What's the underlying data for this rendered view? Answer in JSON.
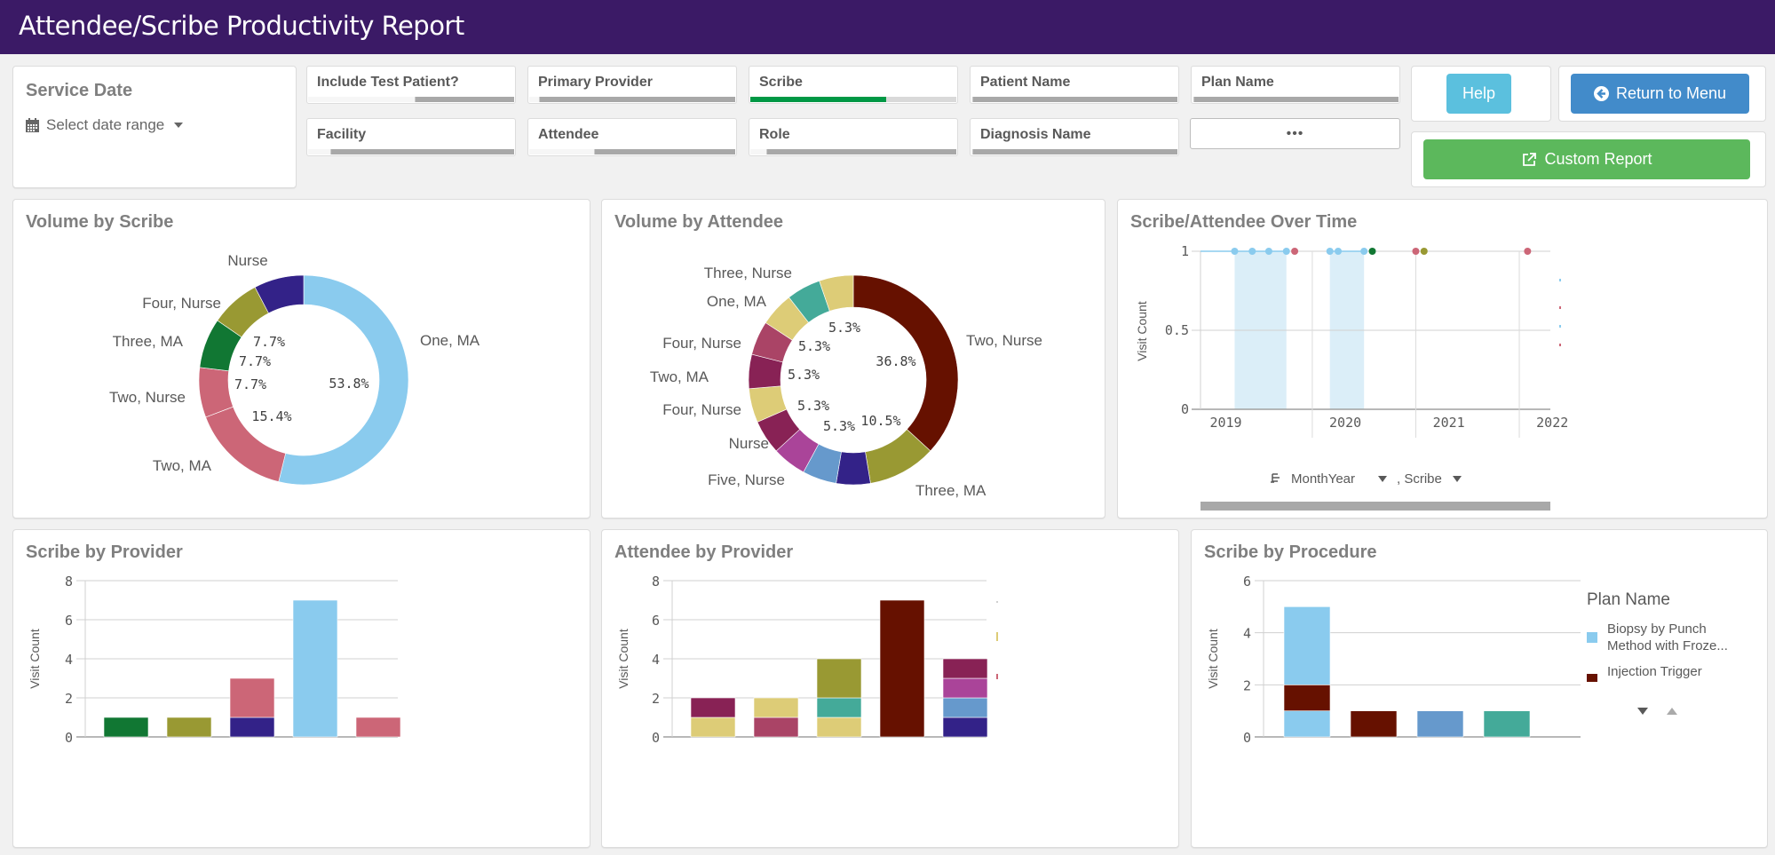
{
  "header": {
    "title": "Attendee/Scribe Productivity Report"
  },
  "filters": {
    "service_date": {
      "label": "Service Date",
      "picker_label": "Select date range"
    },
    "items": [
      {
        "label": "Include Test Patient?",
        "white_fraction": 0.52,
        "selected": false
      },
      {
        "label": "Primary Provider",
        "white_fraction": 0.05,
        "selected": false
      },
      {
        "label": "Scribe",
        "green_fraction": 0.66,
        "selected": true
      },
      {
        "label": "Patient Name",
        "white_fraction": 0.01,
        "selected": false
      },
      {
        "label": "Plan Name",
        "white_fraction": 0.01,
        "selected": false
      },
      {
        "label": "Facility",
        "white_fraction": 0.11,
        "selected": false
      },
      {
        "label": "Attendee",
        "white_fraction": 0.32,
        "selected": false
      },
      {
        "label": "Role",
        "white_fraction": 0.08,
        "selected": false
      },
      {
        "label": "Diagnosis Name",
        "white_fraction": 0.01,
        "selected": false
      }
    ],
    "more_label": "•••"
  },
  "buttons": {
    "help": "Help",
    "return_to_menu": "Return to Menu",
    "custom_report": "Custom Report"
  },
  "colors": {
    "header": "#3b1a66",
    "light_blue": "#8acbee",
    "rose": "#cc6677",
    "green": "#117733",
    "olive": "#999933",
    "indigo": "#332288",
    "maroon": "#661100",
    "sand": "#ddcc77",
    "teal": "#44aa99",
    "wine": "#882255",
    "raspberry": "#aa4466",
    "magenta": "#aa4499",
    "steel_blue": "#6699cc"
  },
  "chart_data": [
    {
      "id": "volume_by_scribe",
      "type": "pie",
      "title": "Volume by Scribe",
      "donut": true,
      "slices": [
        {
          "label": "One, MA",
          "value": 7,
          "pct": "53.8%",
          "color": "#8acbee"
        },
        {
          "label": "Two, MA",
          "value": 2,
          "pct": "15.4%",
          "color": "#cc6677"
        },
        {
          "label": "Two, Nurse",
          "value": 1,
          "pct": "7.7%",
          "color": "#cc6677"
        },
        {
          "label": "Three, MA",
          "value": 1,
          "pct": "7.7%",
          "color": "#117733"
        },
        {
          "label": "Four, Nurse",
          "value": 1,
          "pct": "7.7%",
          "color": "#999933"
        },
        {
          "label": "Nurse",
          "value": 1,
          "pct": "7.7%",
          "color": "#332288"
        }
      ],
      "inner_labels": [
        "53.8%",
        "15.4%",
        "7.7%",
        "7.7%",
        "7.7%"
      ]
    },
    {
      "id": "volume_by_attendee",
      "type": "pie",
      "title": "Volume by Attendee",
      "donut": true,
      "slices": [
        {
          "label": "Two, Nurse",
          "value": 7,
          "pct": "36.8%",
          "color": "#661100"
        },
        {
          "label": "Three, MA",
          "value": 2,
          "pct": "10.5%",
          "color": "#999933"
        },
        {
          "label": "",
          "value": 1,
          "pct": "5.3%",
          "color": "#332288"
        },
        {
          "label": "Five, Nurse",
          "value": 1,
          "pct": "5.3%",
          "color": "#6699cc"
        },
        {
          "label": "",
          "value": 1,
          "pct": "5.3%",
          "color": "#aa4499"
        },
        {
          "label": "Nurse",
          "value": 1,
          "pct": "5.3%",
          "color": "#882255"
        },
        {
          "label": "Four, Nurse",
          "value": 1,
          "pct": "5.3%",
          "color": "#ddcc77"
        },
        {
          "label": "Two, MA",
          "value": 1,
          "pct": "5.3%",
          "color": "#882255"
        },
        {
          "label": "Four, Nurse",
          "value": 1,
          "pct": "5.3%",
          "color": "#aa4466"
        },
        {
          "label": "One, MA",
          "value": 1,
          "pct": "5.3%",
          "color": "#ddcc77"
        },
        {
          "label": "",
          "value": 1,
          "pct": "5.3%",
          "color": "#44aa99"
        },
        {
          "label": "Three, Nurse",
          "value": 1,
          "pct": "5.3%",
          "color": "#ddcc77"
        }
      ],
      "inner_labels": [
        "36.8%",
        "10.5%",
        "5.3%",
        "5.3%",
        "5.3%",
        "5.3%",
        "5.3%"
      ]
    },
    {
      "id": "scribe_attendee_over_time",
      "type": "line",
      "title": "Scribe/Attendee Over Time",
      "ylabel": "Visit Count",
      "yticks": [
        "1",
        "0.5",
        "0"
      ],
      "ylim": [
        0,
        1
      ],
      "xticks": [
        "2019",
        "2020",
        "2021",
        "2022"
      ],
      "points": [
        {
          "t": 2019.0,
          "y": 1,
          "color": "#8acbee"
        },
        {
          "t": 2019.17,
          "y": 1,
          "color": "#8acbee"
        },
        {
          "t": 2019.33,
          "y": 1,
          "color": "#8acbee"
        },
        {
          "t": 2019.5,
          "y": 1,
          "color": "#8acbee"
        },
        {
          "t": 2019.58,
          "y": 1,
          "color": "#cc6677"
        },
        {
          "t": 2019.92,
          "y": 1,
          "color": "#8acbee"
        },
        {
          "t": 2020.0,
          "y": 1,
          "color": "#8acbee"
        },
        {
          "t": 2020.25,
          "y": 1,
          "color": "#8acbee"
        },
        {
          "t": 2020.33,
          "y": 1,
          "color": "#117733"
        },
        {
          "t": 2020.75,
          "y": 1,
          "color": "#cc6677"
        },
        {
          "t": 2020.83,
          "y": 1,
          "color": "#999933"
        },
        {
          "t": 2021.83,
          "y": 1,
          "color": "#cc6677"
        }
      ],
      "shaded_ranges": [
        [
          2019.0,
          2019.5
        ],
        [
          2019.92,
          2020.25
        ]
      ],
      "dimension_labels": [
        "MonthYear",
        ", Scribe"
      ]
    },
    {
      "id": "scribe_by_provider",
      "type": "bar",
      "stacked": true,
      "title": "Scribe by Provider",
      "ylabel": "Visit Count",
      "ylim": [
        0,
        8
      ],
      "yticks": [
        "8",
        "6",
        "4",
        "2",
        "0"
      ],
      "bars": [
        [
          {
            "value": 1,
            "color": "#117733"
          }
        ],
        [
          {
            "value": 1,
            "color": "#999933"
          }
        ],
        [
          {
            "value": 1,
            "color": "#332288"
          },
          {
            "value": 2,
            "color": "#cc6677"
          }
        ],
        [
          {
            "value": 7,
            "color": "#8acbee"
          }
        ],
        [
          {
            "value": 1,
            "color": "#cc6677"
          }
        ]
      ]
    },
    {
      "id": "attendee_by_provider",
      "type": "bar",
      "stacked": true,
      "title": "Attendee by Provider",
      "ylabel": "Visit Count",
      "ylim": [
        0,
        8
      ],
      "yticks": [
        "8",
        "6",
        "4",
        "2",
        "0"
      ],
      "bars": [
        [
          {
            "value": 1,
            "color": "#ddcc77"
          },
          {
            "value": 1,
            "color": "#882255"
          }
        ],
        [
          {
            "value": 1,
            "color": "#aa4466"
          },
          {
            "value": 1,
            "color": "#ddcc77"
          }
        ],
        [
          {
            "value": 1,
            "color": "#ddcc77"
          },
          {
            "value": 1,
            "color": "#44aa99"
          },
          {
            "value": 2,
            "color": "#999933"
          }
        ],
        [
          {
            "value": 7,
            "color": "#661100"
          }
        ],
        [
          {
            "value": 1,
            "color": "#332288"
          },
          {
            "value": 1,
            "color": "#6699cc"
          },
          {
            "value": 1,
            "color": "#aa4499"
          },
          {
            "value": 1,
            "color": "#882255"
          }
        ]
      ]
    },
    {
      "id": "scribe_by_procedure",
      "type": "bar",
      "stacked": true,
      "title": "Scribe by Procedure",
      "ylabel": "Visit Count",
      "ylim": [
        0,
        6
      ],
      "yticks": [
        "6",
        "4",
        "2",
        "0"
      ],
      "bars": [
        [
          {
            "value": 1,
            "color": "#8acbee"
          },
          {
            "value": 1,
            "color": "#661100"
          },
          {
            "value": 3,
            "color": "#8acbee"
          }
        ],
        [
          {
            "value": 1,
            "color": "#661100"
          }
        ],
        [
          {
            "value": 1,
            "color": "#6699cc"
          }
        ],
        [
          {
            "value": 1,
            "color": "#44aa99"
          }
        ]
      ],
      "legend": {
        "title": "Plan Name",
        "position": "right",
        "items": [
          {
            "label": "Biopsy by Punch Method with Froze...",
            "color": "#8acbee"
          },
          {
            "label": "Injection Trigger",
            "color": "#661100"
          }
        ]
      }
    }
  ]
}
